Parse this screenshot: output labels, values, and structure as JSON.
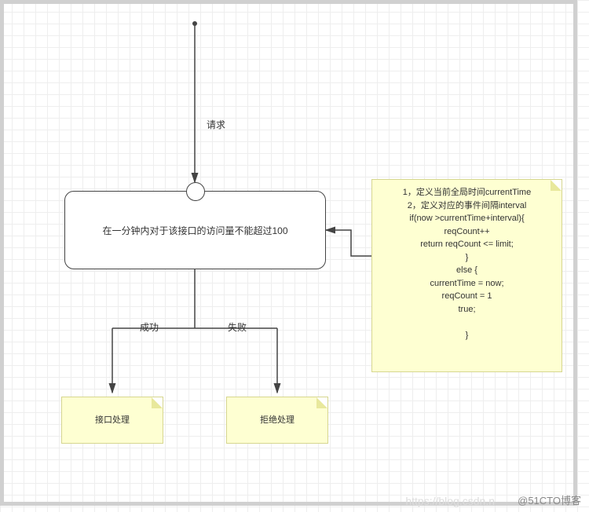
{
  "request_label": "请求",
  "process_text": "在一分钟内对于该接口的访问量不能超过100",
  "success_label": "成功",
  "fail_label": "失败",
  "success_note": "接口处理",
  "fail_note": "拒绝处理",
  "logic_note": "1，定义当前全局时间currentTime\n2，定义对应的事件间隔interval\nif(now >currentTime+interval){\n    reqCount++\n    return reqCount <= limit;\n}\nelse {\n    currentTime = now;\n    reqCount = 1\n    true;\n\n}",
  "watermark_faint": "https://blog.csdn.n",
  "watermark_strong": "@51CTO博客"
}
